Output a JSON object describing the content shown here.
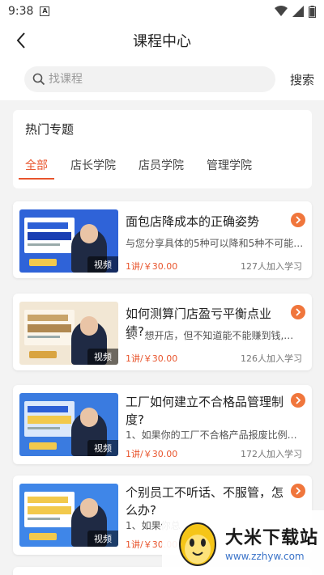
{
  "status_bar": {
    "time": "9:38",
    "notification_badge": "A"
  },
  "header": {
    "title": "课程中心"
  },
  "search": {
    "placeholder": "找课程",
    "button_label": "搜索"
  },
  "topics": {
    "heading": "热门专题",
    "tabs": [
      {
        "label": "全部",
        "active": true
      },
      {
        "label": "店长学院",
        "active": false
      },
      {
        "label": "店员学院",
        "active": false
      },
      {
        "label": "管理学院",
        "active": false
      }
    ]
  },
  "courses": [
    {
      "title": "面包店降成本的正确姿势",
      "desc": "与您分享具体的5种可以降和5种不可能…",
      "price": "1讲/￥30.00",
      "learners": "127人加入学习",
      "tag": "视频",
      "thumb_color": "#2f63d8"
    },
    {
      "title": "如何测算门店盈亏平衡点业绩?",
      "desc": "1、 想开店，但不知道能不能赚到钱,…",
      "price": "1讲/￥30.00",
      "learners": "126人加入学习",
      "tag": "视频",
      "thumb_color": "#f2e7d4"
    },
    {
      "title": "工厂如何建立不合格品管理制度?",
      "desc": "1、如果你的工厂不合格产品报废比例非…",
      "price": "1讲/￥30.00",
      "learners": "172人加入学习",
      "tag": "视频",
      "thumb_color": "#3a7be0"
    },
    {
      "title": "个别员工不听话、不服管，怎么办?",
      "desc": "1、如果你总",
      "price": "1讲/￥30.00",
      "learners": "",
      "tag": "视频",
      "thumb_color": "#3f86e8"
    }
  ],
  "watermark": {
    "title": "大米下载站",
    "url": "www.zzhyw.com"
  },
  "colors": {
    "accent": "#e8552d",
    "arrow": "#f0763c"
  }
}
